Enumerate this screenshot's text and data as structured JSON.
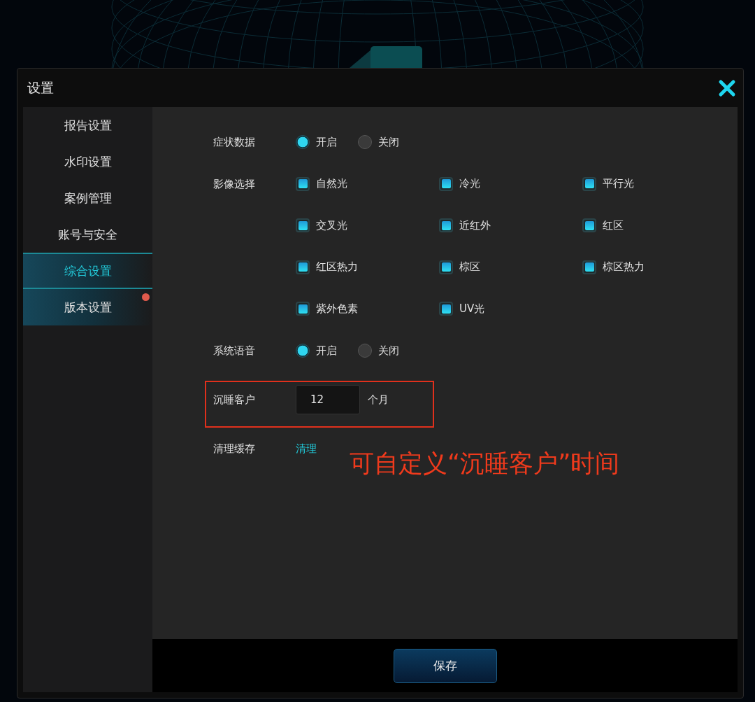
{
  "window": {
    "title": "设置"
  },
  "sidebar": {
    "items": [
      {
        "label": "报告设置",
        "selected": false,
        "highlighted": false,
        "badge": false
      },
      {
        "label": "水印设置",
        "selected": false,
        "highlighted": false,
        "badge": false
      },
      {
        "label": "案例管理",
        "selected": false,
        "highlighted": false,
        "badge": false
      },
      {
        "label": "账号与安全",
        "selected": false,
        "highlighted": false,
        "badge": false
      },
      {
        "label": "综合设置",
        "selected": true,
        "highlighted": true,
        "badge": false
      },
      {
        "label": "版本设置",
        "selected": false,
        "highlighted": true,
        "badge": true
      }
    ]
  },
  "settings": [
    {
      "kind": "radio",
      "label": "症状数据",
      "options": [
        {
          "label": "开启",
          "selected": true
        },
        {
          "label": "关闭",
          "selected": false
        }
      ]
    },
    {
      "kind": "checkboxes",
      "label": "影像选择",
      "options": [
        {
          "label": "自然光",
          "checked": true
        },
        {
          "label": "冷光",
          "checked": true
        },
        {
          "label": "平行光",
          "checked": true
        },
        {
          "label": "交叉光",
          "checked": true
        },
        {
          "label": "近红外",
          "checked": true
        },
        {
          "label": "红区",
          "checked": true
        },
        {
          "label": "红区热力",
          "checked": true
        },
        {
          "label": "棕区",
          "checked": true
        },
        {
          "label": "棕区热力",
          "checked": true
        },
        {
          "label": "紫外色素",
          "checked": true
        },
        {
          "label": "UV光",
          "checked": true
        }
      ]
    },
    {
      "kind": "radio",
      "label": "系统语音",
      "options": [
        {
          "label": "开启",
          "selected": true
        },
        {
          "label": "关闭",
          "selected": false
        }
      ]
    },
    {
      "kind": "number",
      "label": "沉睡客户",
      "value": "12",
      "unit": "个月",
      "highlighted": true
    },
    {
      "kind": "action",
      "label": "清理缓存",
      "link": "清理"
    }
  ],
  "annotation": {
    "text": "可自定义“沉睡客户”时间"
  },
  "save_button": "保存"
}
